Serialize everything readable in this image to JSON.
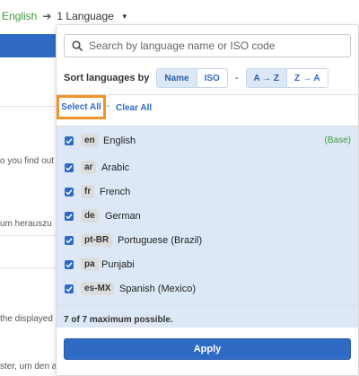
{
  "breadcrumb": {
    "source": "English",
    "target": "1 Language"
  },
  "background_text": [
    "o you find out",
    "um herauszu",
    "the displayed",
    "ster, um den a"
  ],
  "search": {
    "placeholder": "Search by language name or ISO code",
    "value": ""
  },
  "sort": {
    "label": "Sort languages by",
    "options": [
      "Name",
      "ISO"
    ],
    "active_option": "Name",
    "separator": "-",
    "directions": [
      "A → Z",
      "Z → A"
    ],
    "active_direction": "A → Z"
  },
  "selection": {
    "select_all": "Select All",
    "separator": "-",
    "clear_all": "Clear All"
  },
  "languages": [
    {
      "code": "en",
      "name": "English",
      "checked": true,
      "tag": "(Base)"
    },
    {
      "code": "ar",
      "name": "Arabic",
      "checked": true
    },
    {
      "code": "fr",
      "name": "French",
      "checked": true
    },
    {
      "code": "de",
      "name": "German",
      "checked": true
    },
    {
      "code": "pt-BR",
      "name": "Portuguese (Brazil)",
      "checked": true
    },
    {
      "code": "pa",
      "name": "Punjabi",
      "checked": true
    },
    {
      "code": "es-MX",
      "name": "Spanish (Mexico)",
      "checked": true
    }
  ],
  "footer": {
    "count_text": "7 of 7 maximum possible.",
    "apply_label": "Apply"
  },
  "colors": {
    "accent": "#2f6bc4",
    "highlight": "#f0932b",
    "base_tag": "#3f9b3f",
    "list_bg": "#dde8f6"
  }
}
